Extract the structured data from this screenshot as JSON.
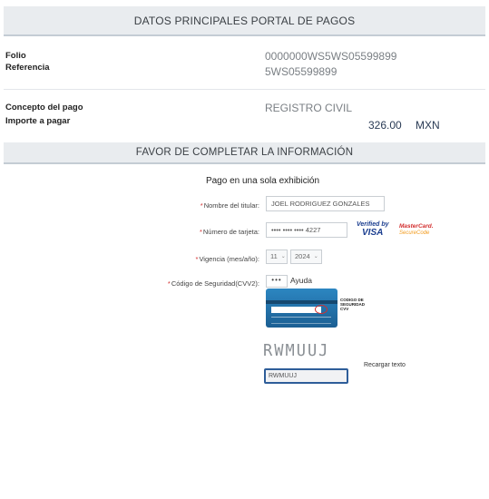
{
  "header": {
    "title": "DATOS PRINCIPALES PORTAL DE PAGOS"
  },
  "summary": {
    "folio_label": "Folio",
    "folio_value": "0000000WS5WS05599899",
    "referencia_label": "Referencia",
    "referencia_value": "5WS05599899",
    "concepto_label": "Concepto del pago",
    "concepto_value": "REGISTRO CIVIL",
    "importe_label": "Importe a pagar",
    "importe_amount": "326.00",
    "importe_currency": "MXN"
  },
  "form_section": {
    "title": "FAVOR DE COMPLETAR LA INFORMACIÓN",
    "subtitle": "Pago en una sola exhibición",
    "required_mark": "*",
    "titular_label": "Nombre del titular:",
    "titular_value": "JOEL RODRIGUEZ GONZALES",
    "tarjeta_label": "Número de tarjeta:",
    "tarjeta_value": "•••• •••• •••• 4227",
    "vigencia_label": "Vigencia (mes/año):",
    "vigencia_month": "11",
    "vigencia_year": "2024",
    "cvv_label": "Código de Seguridad(CVV2):",
    "cvv_value": "•••",
    "ayuda_label": "Ayuda",
    "card_caption": "CODIGO DE SEGURIDAD CVV",
    "captcha_text": "RWMUUJ",
    "reload_label": "Recargar texto",
    "captcha_value": "RWMUUJ"
  },
  "badges": {
    "verified_by": "Verified by",
    "visa": "VISA",
    "mastercard": "MasterCard.",
    "securecode": "SecureCode"
  },
  "colors": {
    "header_bg": "#e9ecef",
    "accent_blue": "#2e5d99",
    "required": "#d32f2f",
    "value_gray": "#7a7f84"
  }
}
